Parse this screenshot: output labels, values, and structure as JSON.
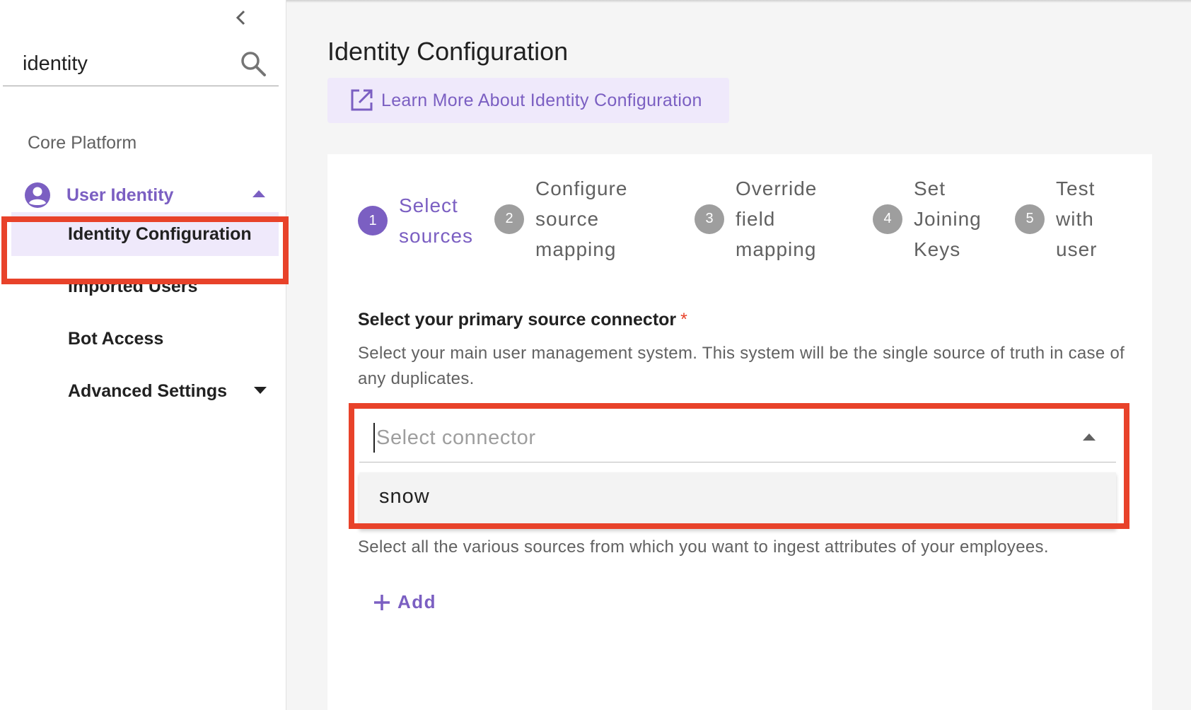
{
  "sidebar": {
    "search_value": "identity",
    "section_title": "Core Platform",
    "group_label": "User Identity",
    "items": [
      {
        "label": "Identity Configuration"
      },
      {
        "label": "Imported Users"
      },
      {
        "label": "Bot Access"
      },
      {
        "label": "Advanced Settings"
      }
    ]
  },
  "main": {
    "title": "Identity Configuration",
    "learn_more_label": "Learn More About Identity Configuration",
    "steps": [
      {
        "number": "1",
        "lines": [
          "Select",
          "sources"
        ]
      },
      {
        "number": "2",
        "lines": [
          "Configure",
          "source",
          "mapping"
        ]
      },
      {
        "number": "3",
        "lines": [
          "Override",
          "field",
          "mapping"
        ]
      },
      {
        "number": "4",
        "lines": [
          "Set",
          "Joining",
          "Keys"
        ]
      },
      {
        "number": "5",
        "lines": [
          "Test",
          "with",
          "user"
        ]
      }
    ],
    "primary_connector": {
      "label": "Select your primary source connector",
      "required_mark": "*",
      "help": "Select your main user management system. This system will be the single source of truth in case of any duplicates.",
      "placeholder": "Select connector",
      "options": [
        "snow"
      ]
    },
    "sources_help": "Select all the various sources from which you want to ingest attributes of your employees.",
    "add_label": "Add"
  },
  "colors": {
    "accent": "#7b5fc2",
    "accent_light": "#efe9fb",
    "highlight": "#e8422a",
    "inactive_step": "#9e9e9e"
  },
  "icons": [
    "chevron-left-icon",
    "search-icon",
    "account-circle-icon",
    "caret-up-icon",
    "caret-down-icon",
    "open-in-new-icon",
    "plus-icon"
  ]
}
